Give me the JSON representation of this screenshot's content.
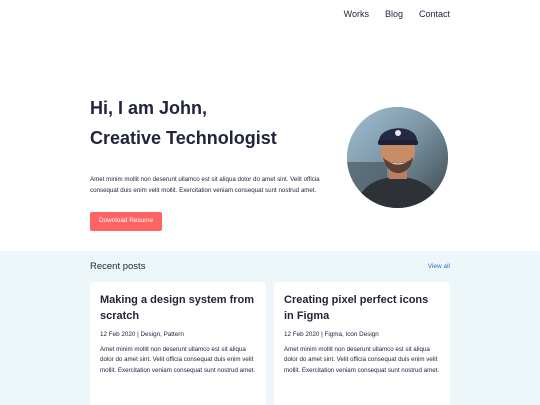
{
  "nav": {
    "items": [
      "Works",
      "Blog",
      "Contact"
    ]
  },
  "hero": {
    "title_line1": "Hi, I am John,",
    "title_line2": "Creative Technologist",
    "text": "Amet minim mollit non deserunt ullamco est sit aliqua dolor do amet sint. Velit officia consequat duis enim velit mollit. Exercitation veniam consequat sunt nostrud amet.",
    "button_label": "Download Resume"
  },
  "posts": {
    "title": "Recent posts",
    "view_all": "View all",
    "items": [
      {
        "title": "Making a design system from scratch",
        "meta": "12 Feb 2020 | Design, Pattern",
        "text": "Amet minim mollit non deserunt ullamco est sit aliqua dolor do amet sint. Velit officia consequat duis enim velit mollit. Exercitation veniam consequat sunt nostrud amet."
      },
      {
        "title": "Creating pixel perfect icons in Figma",
        "meta": "12 Feb 2020 | Figma, Icon Design",
        "text": "Amet minim mollit non deserunt ullamco est sit aliqua dolor do amet sint. Velit officia consequat duis enim velit mollit. Exercitation veniam consequat sunt nostrud amet."
      }
    ]
  },
  "colors": {
    "accent": "#ff6464",
    "dark": "#21243d",
    "section_bg": "#edf7fa",
    "link": "#2f6fd6"
  }
}
